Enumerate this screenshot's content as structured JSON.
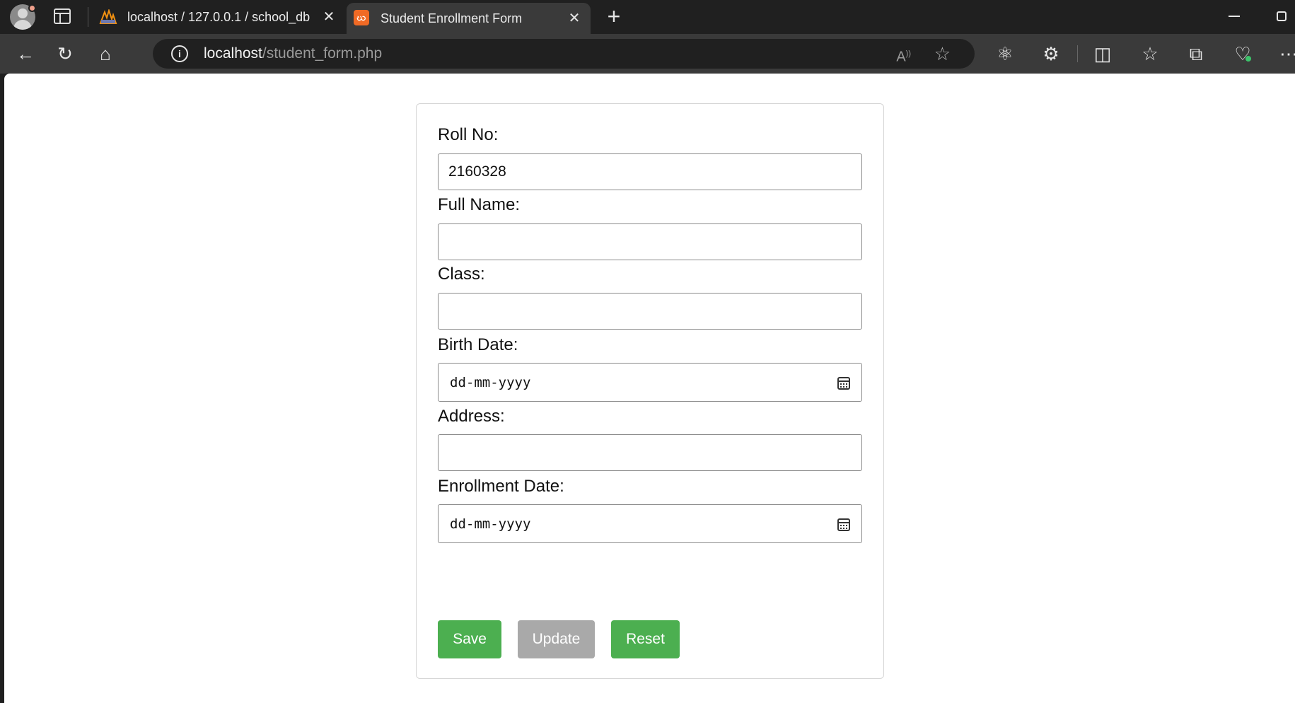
{
  "browser": {
    "tabs": [
      {
        "title": "localhost / 127.0.0.1 / school_db",
        "favicon": "phpmyadmin-icon",
        "active": false
      },
      {
        "title": "Student Enrollment Form",
        "favicon": "xampp-icon",
        "active": true
      }
    ],
    "address": {
      "host": "localhost",
      "path": "/student_form.php"
    }
  },
  "form": {
    "fields": {
      "roll_no": {
        "label": "Roll No:",
        "value": "2160328"
      },
      "full_name": {
        "label": "Full Name:",
        "value": ""
      },
      "class": {
        "label": "Class:",
        "value": ""
      },
      "birth_date": {
        "label": "Birth Date:",
        "value": "dd-mm-yyyy"
      },
      "address": {
        "label": "Address:",
        "value": ""
      },
      "enrollment_date": {
        "label": "Enrollment Date:",
        "value": "dd-mm-yyyy"
      }
    },
    "buttons": {
      "save": "Save",
      "update": "Update",
      "reset": "Reset"
    },
    "colors": {
      "primary_button": "#4caf50",
      "disabled_button": "#a9a9a9"
    }
  }
}
